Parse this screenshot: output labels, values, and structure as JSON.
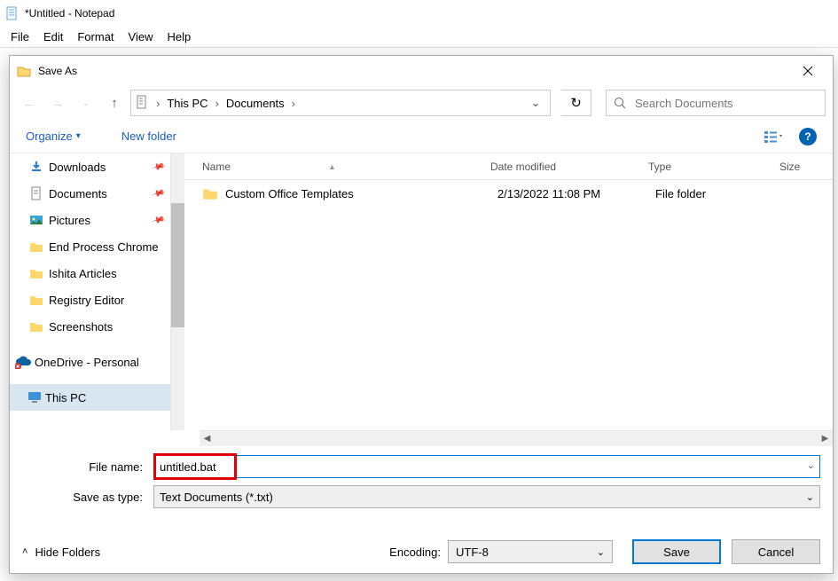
{
  "notepad": {
    "title": "*Untitled - Notepad",
    "menu": [
      "File",
      "Edit",
      "Format",
      "View",
      "Help"
    ]
  },
  "dialog": {
    "title": "Save As",
    "breadcrumb": [
      "This PC",
      "Documents"
    ],
    "search_placeholder": "Search Documents",
    "toolbar": {
      "organize": "Organize",
      "new_folder": "New folder"
    },
    "sidebar": [
      {
        "label": "Downloads",
        "icon": "download",
        "pinned": true
      },
      {
        "label": "Documents",
        "icon": "document",
        "pinned": true
      },
      {
        "label": "Pictures",
        "icon": "pictures",
        "pinned": true
      },
      {
        "label": "End Process Chrome",
        "icon": "folder"
      },
      {
        "label": "Ishita Articles",
        "icon": "folder"
      },
      {
        "label": "Registry Editor",
        "icon": "folder"
      },
      {
        "label": "Screenshots",
        "icon": "folder"
      },
      {
        "label": "OneDrive - Personal",
        "icon": "onedrive",
        "class": "onedrive"
      },
      {
        "label": "This PC",
        "icon": "thispc",
        "class": "thispc",
        "selected": true
      }
    ],
    "columns": {
      "name": "Name",
      "date": "Date modified",
      "type": "Type",
      "size": "Size"
    },
    "rows": [
      {
        "name": "Custom Office Templates",
        "date": "2/13/2022 11:08 PM",
        "type": "File folder"
      }
    ],
    "form": {
      "file_name_label": "File name:",
      "file_name_value": "untitled.bat",
      "save_type_label": "Save as type:",
      "save_type_value": "Text Documents (*.txt)"
    },
    "footer": {
      "hide_folders": "Hide Folders",
      "encoding_label": "Encoding:",
      "encoding_value": "UTF-8",
      "save": "Save",
      "cancel": "Cancel"
    }
  }
}
